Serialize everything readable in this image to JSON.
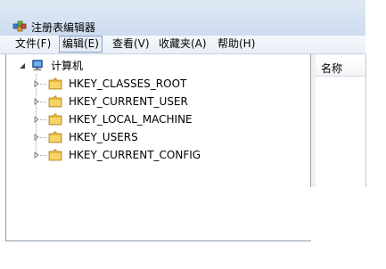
{
  "window": {
    "title": "注册表编辑器",
    "app_icon": "regedit-icon"
  },
  "menu": {
    "items": [
      {
        "label": "文件(F)"
      },
      {
        "label": "编辑(E)",
        "active": true
      },
      {
        "label": "查看(V)"
      },
      {
        "label": "收藏夹(A)"
      },
      {
        "label": "帮助(H)"
      }
    ]
  },
  "tree": {
    "root": {
      "label": "计算机",
      "icon": "computer-icon",
      "expanded": true
    },
    "children": [
      {
        "label": "HKEY_CLASSES_ROOT",
        "icon": "folder-icon"
      },
      {
        "label": "HKEY_CURRENT_USER",
        "icon": "folder-icon"
      },
      {
        "label": "HKEY_LOCAL_MACHINE",
        "icon": "folder-icon"
      },
      {
        "label": "HKEY_USERS",
        "icon": "folder-icon"
      },
      {
        "label": "HKEY_CURRENT_CONFIG",
        "icon": "folder-icon"
      }
    ]
  },
  "list": {
    "columns": [
      {
        "label": "名称"
      }
    ]
  },
  "colors": {
    "titlebar": "#d4e1f1",
    "folder": "#e8b93c"
  }
}
